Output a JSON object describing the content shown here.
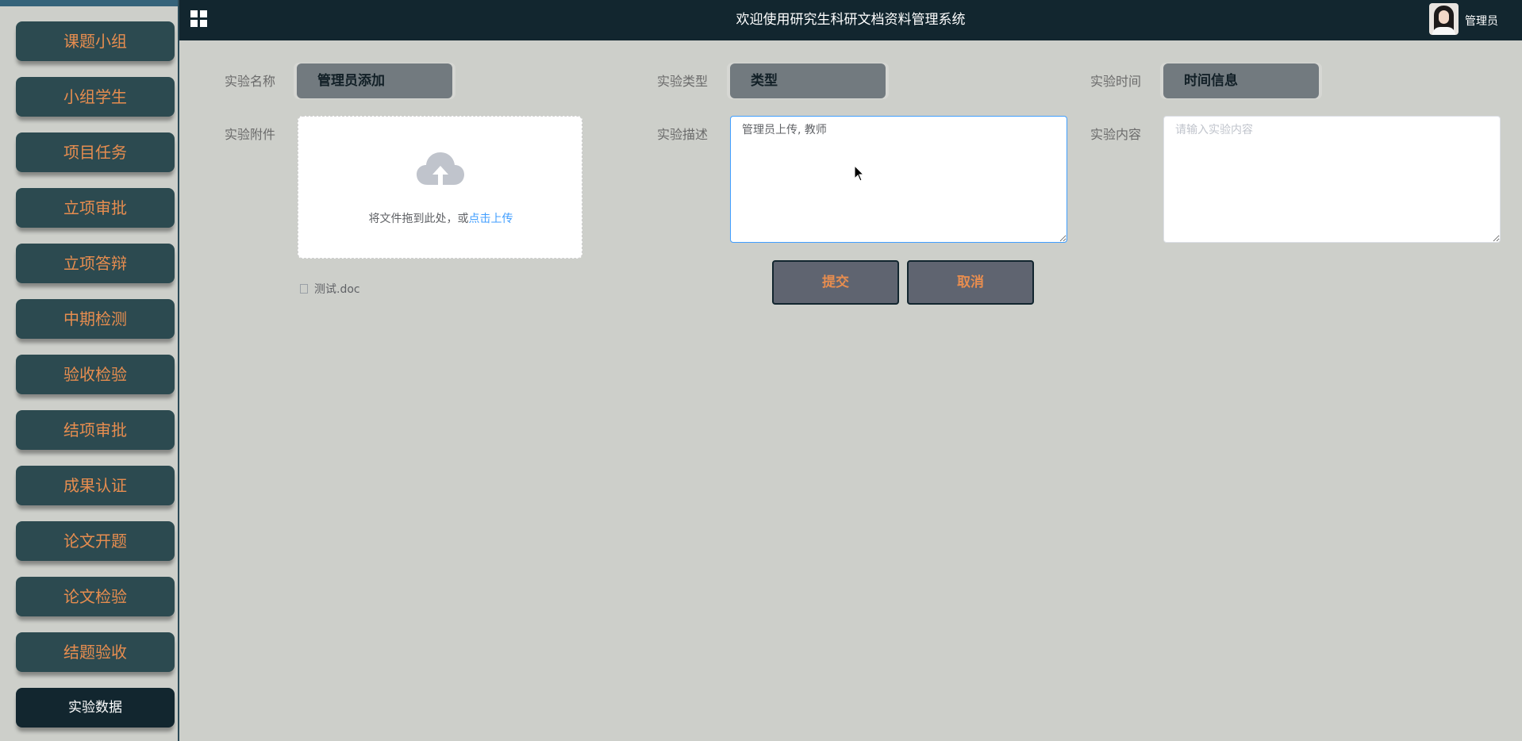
{
  "header": {
    "title": "欢迎使用研究生科研文档资料管理系统",
    "user_name": "管理员"
  },
  "sidebar": {
    "items": [
      {
        "label": "课题小组"
      },
      {
        "label": "小组学生"
      },
      {
        "label": "项目任务"
      },
      {
        "label": "立项审批"
      },
      {
        "label": "立项答辩"
      },
      {
        "label": "中期检测"
      },
      {
        "label": "验收检验"
      },
      {
        "label": "结项审批"
      },
      {
        "label": "成果认证"
      },
      {
        "label": "论文开题"
      },
      {
        "label": "论文检验"
      },
      {
        "label": "结题验收"
      },
      {
        "label": "实验数据",
        "active": true
      }
    ]
  },
  "form": {
    "name_label": "实验名称",
    "name_value": "管理员添加",
    "type_label": "实验类型",
    "type_value": "类型",
    "time_label": "实验时间",
    "time_value": "时间信息",
    "attachment_label": "实验附件",
    "upload_hint": "将文件拖到此处，或",
    "upload_link": "点击上传",
    "file_name": "测试.doc",
    "description_label": "实验描述",
    "description_value": "管理员上传, 教师",
    "content_label": "实验内容",
    "content_placeholder": "请输入实验内容",
    "submit_label": "提交",
    "cancel_label": "取消"
  },
  "colors": {
    "header_bg": "#12262f",
    "sidebar_btn": "#2c4a50",
    "accent_text": "#e78d4f",
    "page_bg": "#cdcfca",
    "link": "#409eff"
  },
  "icons": [
    "grid-icon",
    "avatar",
    "cloud-upload-icon",
    "document-icon"
  ]
}
